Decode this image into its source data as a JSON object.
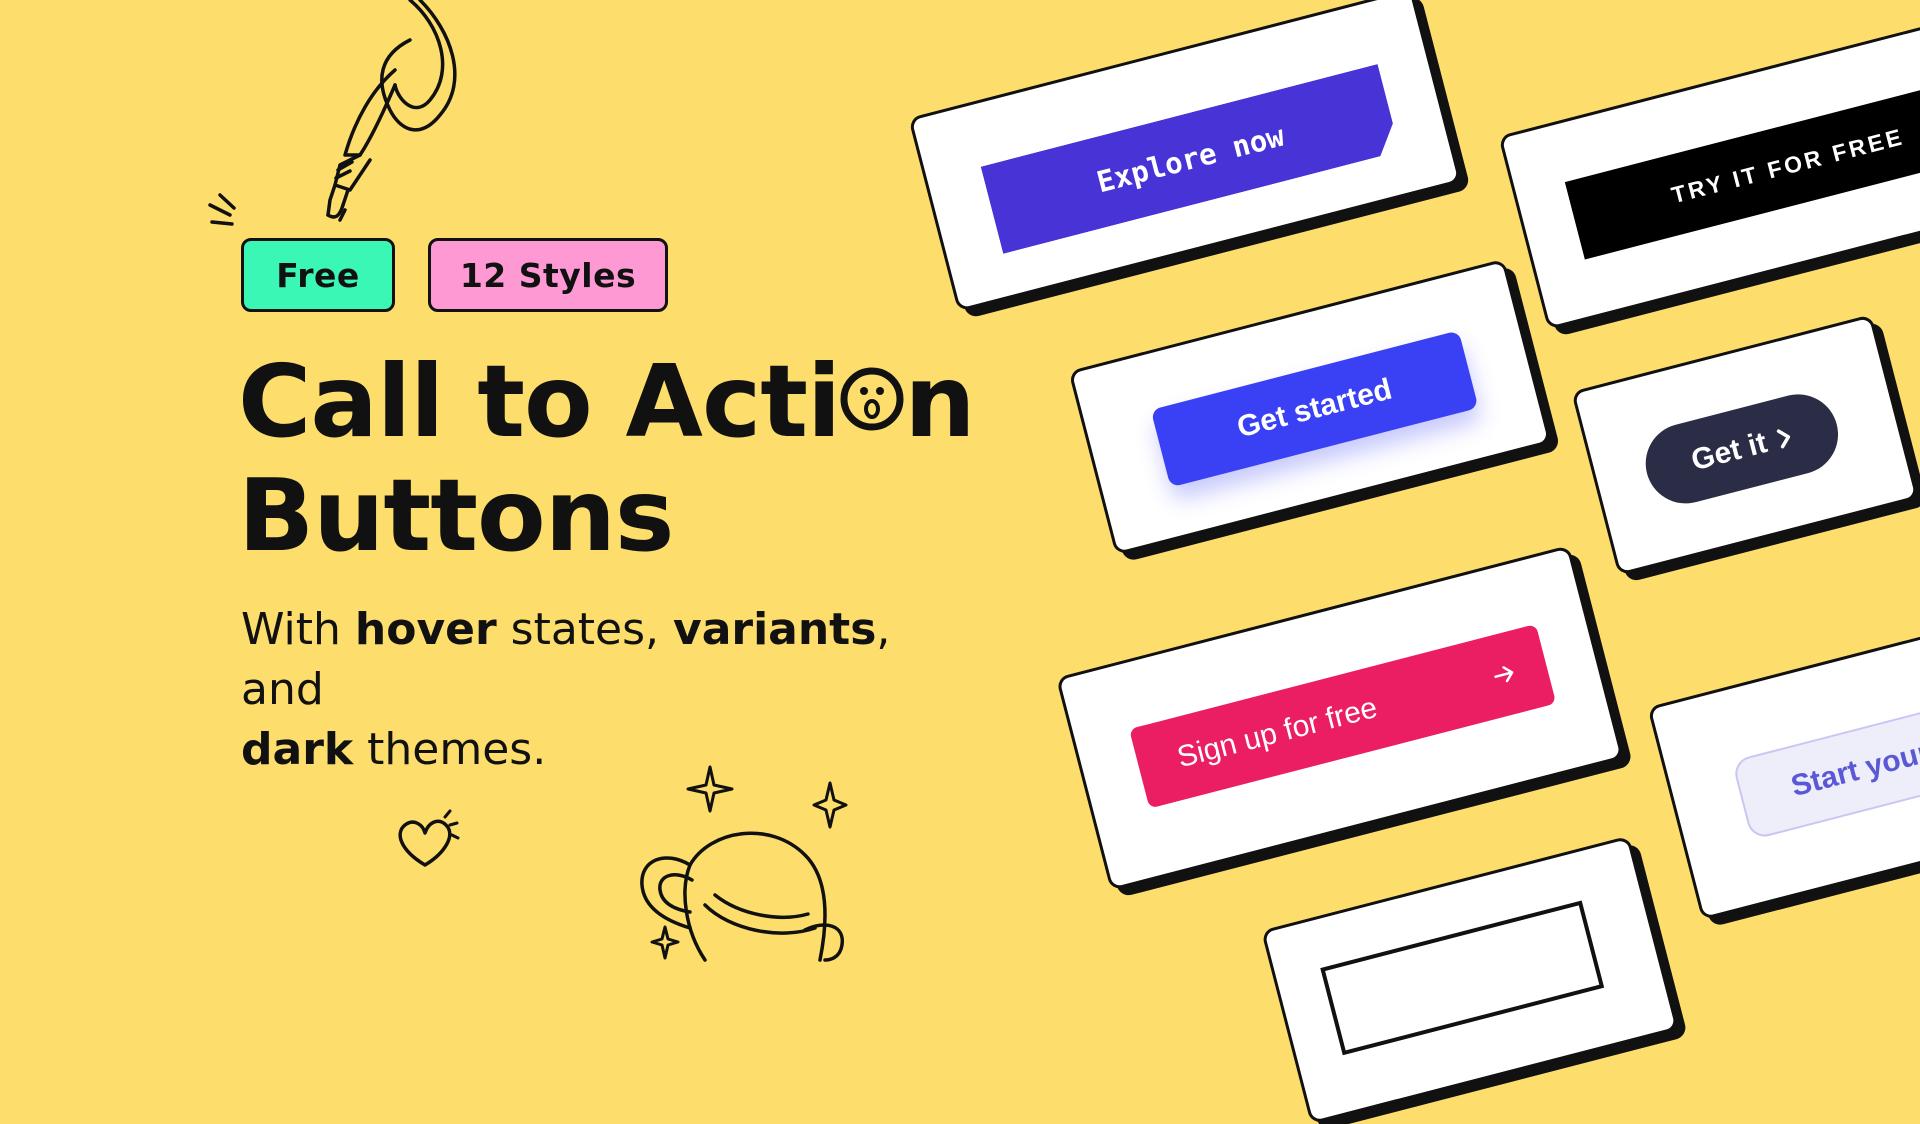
{
  "badges": {
    "free": "Free",
    "styles": "12 Styles"
  },
  "heading": {
    "line1_part1": "Call to Acti",
    "line1_part2": "n",
    "line2": "Buttons"
  },
  "subtitle": {
    "t1": "With ",
    "b1": "hover",
    "t2": " states, ",
    "b2": "variants",
    "t3": ", and",
    "b3": "dark",
    "t4": " themes."
  },
  "buttons": {
    "explore": "Explore now",
    "try": "TRY IT FOR FREE",
    "get_started": "Get started",
    "get_it": "Get it",
    "sign_up": "Sign up for free",
    "start": "Start your"
  },
  "colors": {
    "background": "#FDDD6C",
    "free_badge": "#3AF7B5",
    "styles_badge": "#FF99D4",
    "explore": "#4733D6",
    "get_started": "#3A41F5",
    "get_it": "#2B2D47",
    "sign_up": "#EB1D63",
    "start": "#EEEEFB"
  },
  "icons": [
    "pointing-hand-doodle",
    "face-doodle",
    "heart-doodle",
    "trophy-doodle",
    "sparkle-doodle",
    "chevron-right-icon",
    "arrow-right-icon"
  ]
}
